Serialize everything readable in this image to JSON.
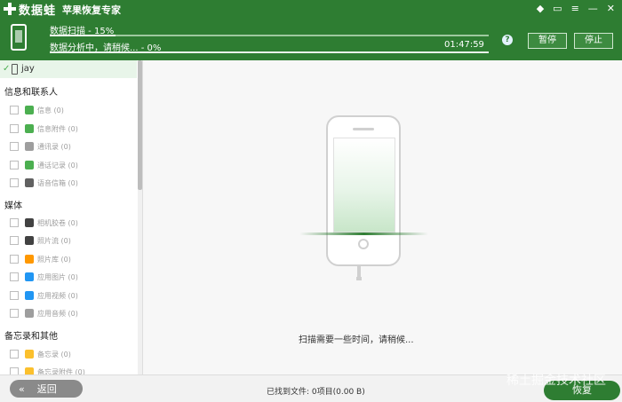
{
  "app": {
    "logo": "数据蛙",
    "subtitle": "苹果恢复专家"
  },
  "window_controls": [
    {
      "name": "diamond-icon",
      "symbol": "◆"
    },
    {
      "name": "chat-icon",
      "symbol": "▭"
    },
    {
      "name": "menu-icon",
      "symbol": "≡"
    },
    {
      "name": "minimize-icon",
      "symbol": "—"
    },
    {
      "name": "close-icon",
      "symbol": "✕"
    }
  ],
  "progress": {
    "scan_label": "数据扫描 - 15%",
    "scan_fraction": 0.15,
    "analysis_label": "数据分析中，请稍候... - 0%",
    "elapsed": "01:47:59",
    "help": "?",
    "pause": "暂停",
    "stop": "停止"
  },
  "sidebar": {
    "device": {
      "check": "✓",
      "name": "jay"
    },
    "sections": [
      {
        "title": "信息和联系人",
        "items": [
          {
            "label": "信息 (0)",
            "icon": "message-icon",
            "color": "#4caf50"
          },
          {
            "label": "信息附件 (0)",
            "icon": "message-attachment-icon",
            "color": "#4caf50"
          },
          {
            "label": "通讯录 (0)",
            "icon": "contacts-icon",
            "color": "#9e9e9e"
          },
          {
            "label": "通话记录 (0)",
            "icon": "phone-icon",
            "color": "#4caf50"
          },
          {
            "label": "语音信箱 (0)",
            "icon": "voicemail-icon",
            "color": "#616161"
          }
        ]
      },
      {
        "title": "媒体",
        "items": [
          {
            "label": "相机胶卷 (0)",
            "icon": "camera-icon",
            "color": "#424242"
          },
          {
            "label": "照片流 (0)",
            "icon": "photo-stream-icon",
            "color": "#424242"
          },
          {
            "label": "照片库 (0)",
            "icon": "photo-library-icon",
            "color": "#ff9800"
          },
          {
            "label": "应用图片 (0)",
            "icon": "app-photo-icon",
            "color": "#2196f3"
          },
          {
            "label": "应用视频 (0)",
            "icon": "app-video-icon",
            "color": "#2196f3"
          },
          {
            "label": "应用音频 (0)",
            "icon": "app-audio-icon",
            "color": "#9e9e9e"
          }
        ]
      },
      {
        "title": "备忘录和其他",
        "items": [
          {
            "label": "备忘录 (0)",
            "icon": "notes-icon",
            "color": "#fbc02d"
          },
          {
            "label": "备忘录附件 (0)",
            "icon": "notes-attachment-icon",
            "color": "#fbc02d"
          }
        ]
      }
    ]
  },
  "main": {
    "scan_message": "扫描需要一些时间，请稍候..."
  },
  "bottom": {
    "back_arrow": "«",
    "back_label": "返回",
    "found": "已找到文件: 0项目(0.00 B)",
    "recover": "恢复",
    "watermark": "稀土掘金技术社区"
  }
}
